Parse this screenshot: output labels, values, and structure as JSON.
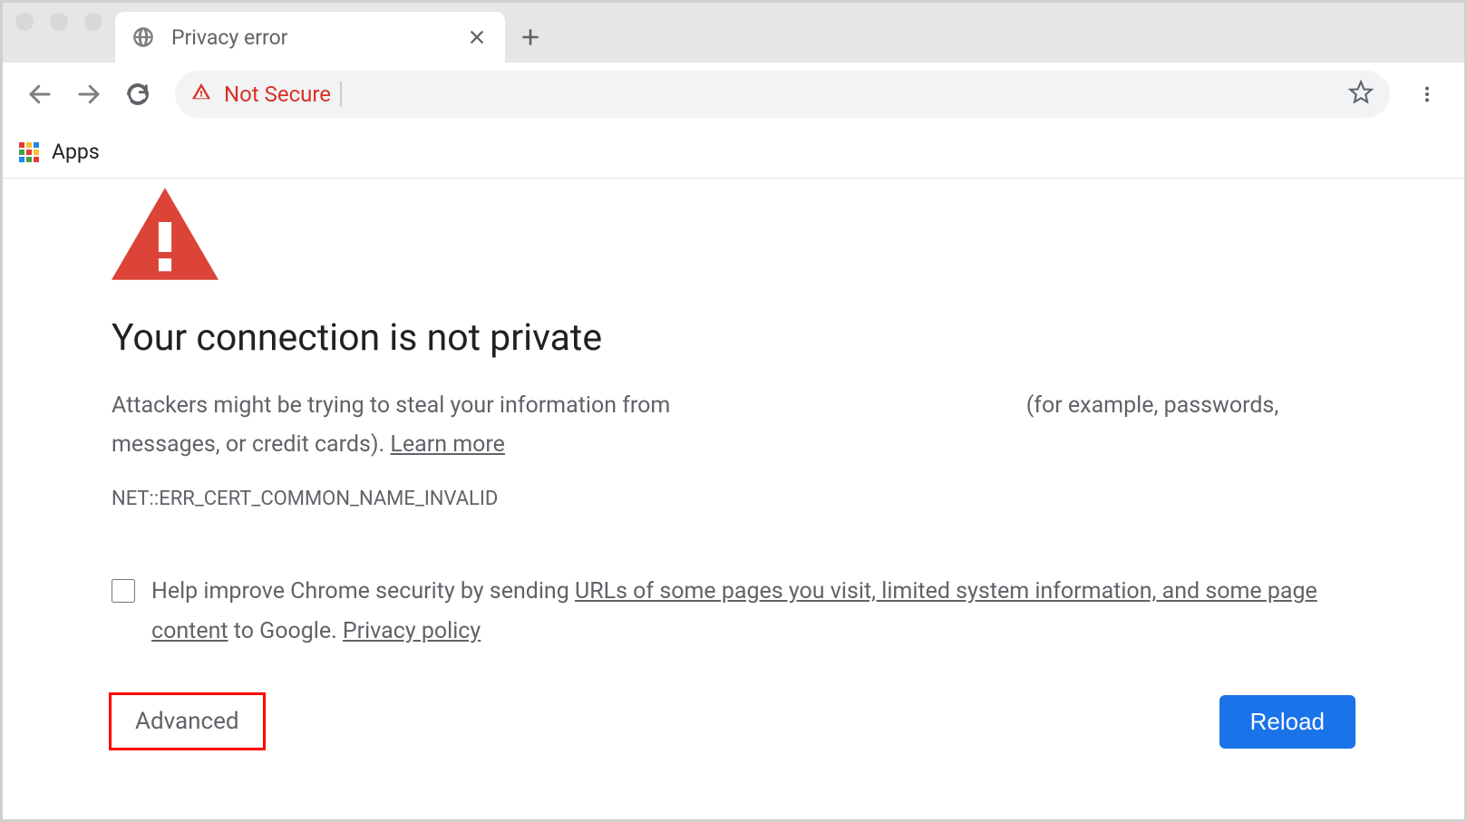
{
  "tab": {
    "title": "Privacy error"
  },
  "toolbar": {
    "not_secure_label": "Not Secure",
    "url_value": ""
  },
  "bookmark_bar": {
    "apps_label": "Apps"
  },
  "error_page": {
    "heading": "Your connection is not private",
    "body_prefix": "Attackers might be trying to steal your information from ",
    "body_middle_gap": "",
    "body_suffix_prefix": " (for example, passwords, messages, or credit cards). ",
    "learn_more": "Learn more",
    "error_code": "NET::ERR_CERT_COMMON_NAME_INVALID",
    "ussr": {
      "prefix": "Help improve Chrome security by sending ",
      "link1": "URLs of some pages you visit, limited system information, and some page content",
      "mid": " to Google. ",
      "link2": "Privacy policy"
    },
    "advanced_label": "Advanced",
    "reload_label": "Reload"
  },
  "colors": {
    "danger": "#d93025",
    "primary": "#1a73e8",
    "annotation": "#ff0000"
  }
}
